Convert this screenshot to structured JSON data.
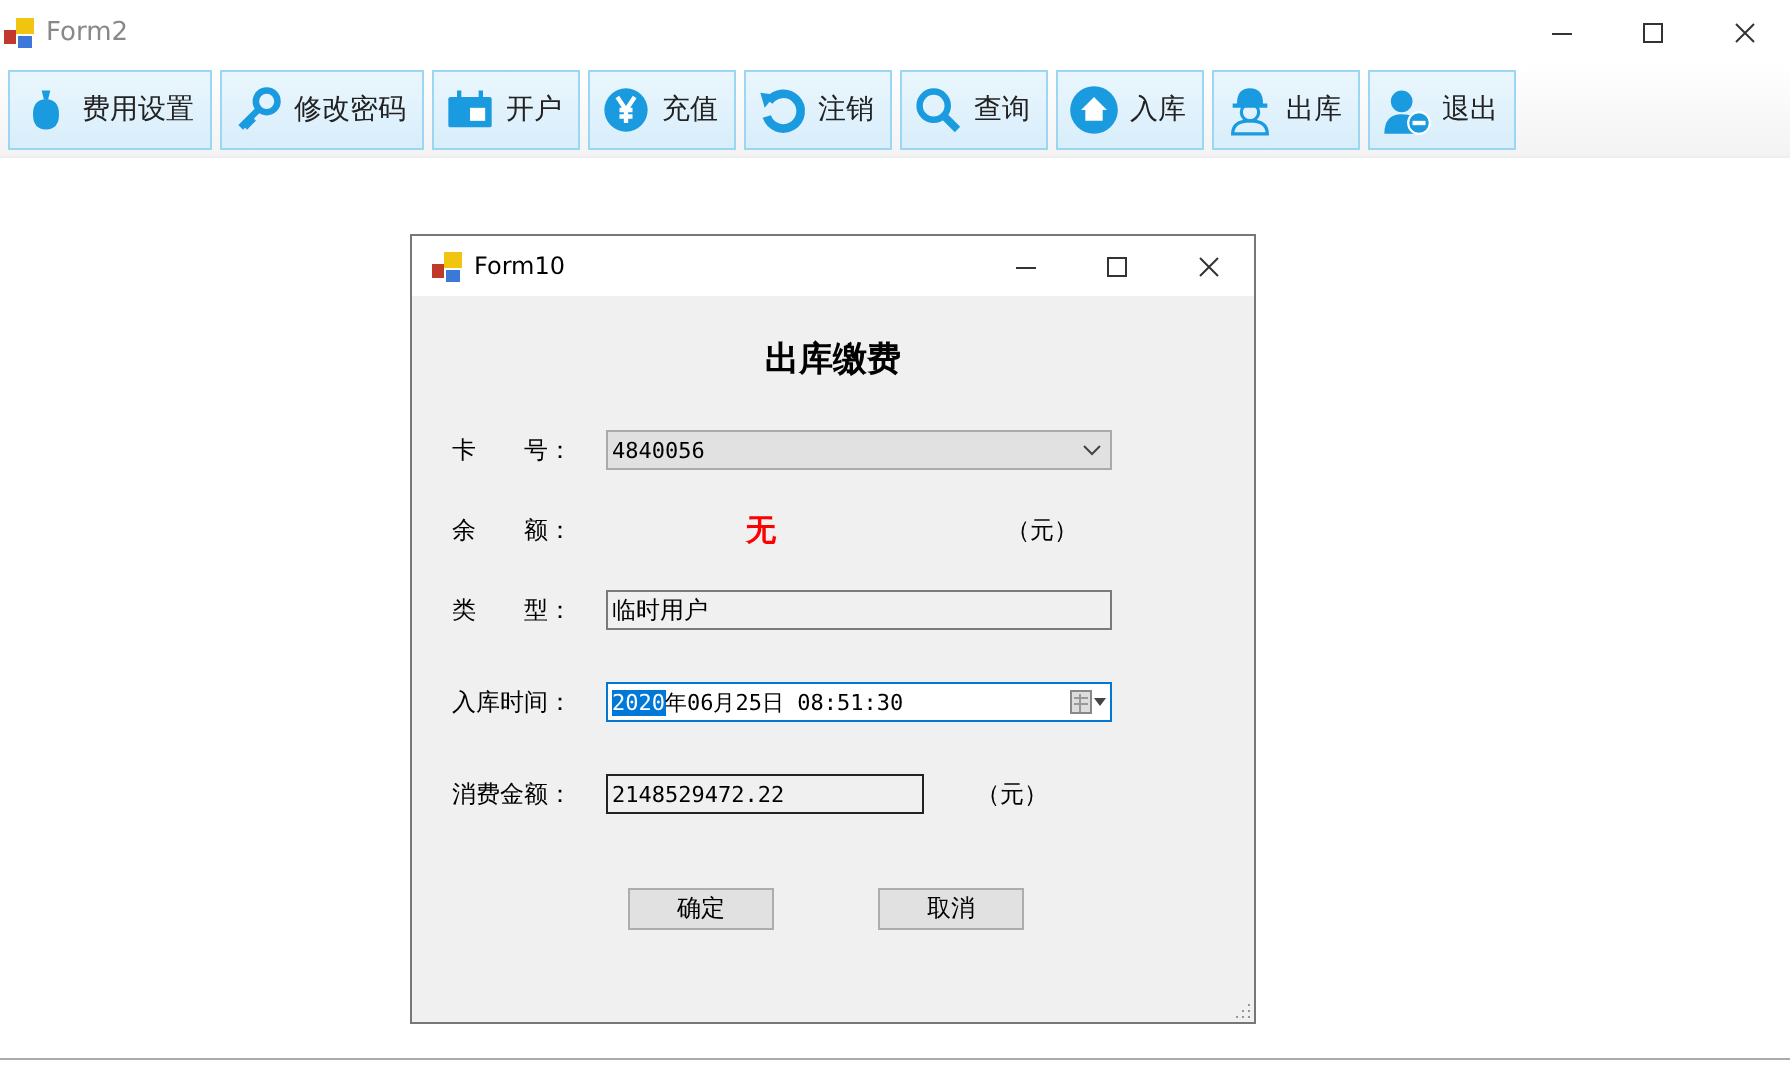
{
  "window": {
    "title": "Form2"
  },
  "toolbar": [
    {
      "label": "费用设置"
    },
    {
      "label": "修改密码"
    },
    {
      "label": "开户"
    },
    {
      "label": "充值"
    },
    {
      "label": "注销"
    },
    {
      "label": "查询"
    },
    {
      "label": "入库"
    },
    {
      "label": "出库"
    },
    {
      "label": "退出"
    }
  ],
  "dialog": {
    "title": "Form10",
    "heading": "出库缴费",
    "rows": [
      {
        "kind": "dropdown",
        "label": "卡　　号：",
        "value": "4840056"
      },
      {
        "kind": "reading",
        "label": "余　　额：",
        "value": "无",
        "unit": "（元）"
      },
      {
        "kind": "readonly",
        "label": "类　　型：",
        "value": "临时用户"
      },
      {
        "kind": "date",
        "label": "入库时间：",
        "selected_text": "2020",
        "value": "年06月25日  08:51:30",
        "focused": true
      },
      {
        "kind": "amount",
        "label": "消费金额：",
        "value": "2148529472.22",
        "unit": "（元）"
      }
    ],
    "buttons": [
      "确定",
      "取消"
    ]
  }
}
